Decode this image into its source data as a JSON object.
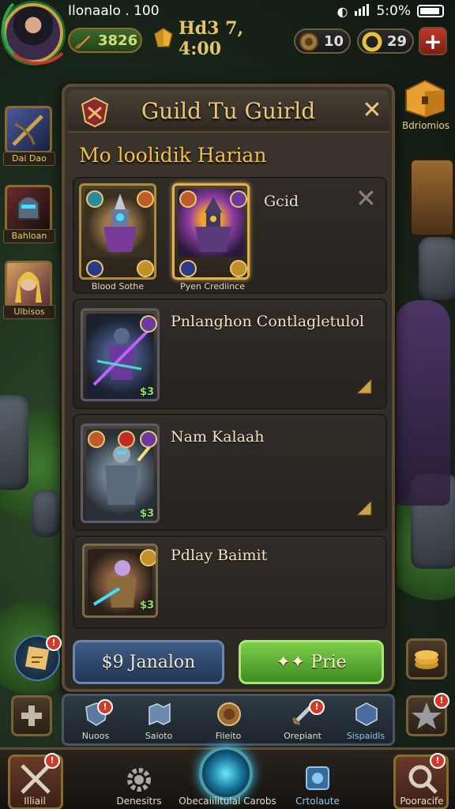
{
  "status_bar": {
    "left_text": "Ilonaalo . 100",
    "right_text": "5:0%"
  },
  "hud": {
    "gold": "3826",
    "gems": "Hd3 7, 4:00",
    "resource_a": "10",
    "resource_b": "29"
  },
  "side_left": [
    {
      "label": "Dai Dao"
    },
    {
      "label": "Bahloan"
    },
    {
      "label": "Ulbisos"
    }
  ],
  "side_right": {
    "chest_label": "Bdriomios"
  },
  "panel": {
    "title": "Guild Tu Guirld",
    "subtitle": "Mo loolidik Harian",
    "rows": [
      {
        "title": "Gcid",
        "cards": [
          {
            "caption": "Blood Sothe"
          },
          {
            "caption": "Pyen Crediince"
          }
        ]
      },
      {
        "title": "Pnlanghon Contlagletulol",
        "level": "$3"
      },
      {
        "title": "Nam Kalaah",
        "level": "$3"
      },
      {
        "title": "Pdlay Baimit",
        "level": "$3"
      }
    ]
  },
  "actions": {
    "primary_label": "$9 Janalon",
    "secondary_label": "✦✦ Prie"
  },
  "sub_tabs": [
    {
      "label": "Nuoos"
    },
    {
      "label": "Saioto"
    },
    {
      "label": "Fileito"
    },
    {
      "label": "Orepiant"
    },
    {
      "label": "Sispaidls"
    }
  ],
  "bottom_nav": [
    {
      "label": "Illiail"
    },
    {
      "label": "Denesitrs"
    },
    {
      "label": "Obecaiilitulal Carobs"
    },
    {
      "label": "Crtolaute"
    },
    {
      "label": "Pooracife"
    }
  ],
  "colors": {
    "accent_gold": "#e8c87a",
    "primary_blue": "#3f5c86",
    "success_green": "#6cc03a",
    "badge_red": "#d23a2a"
  }
}
